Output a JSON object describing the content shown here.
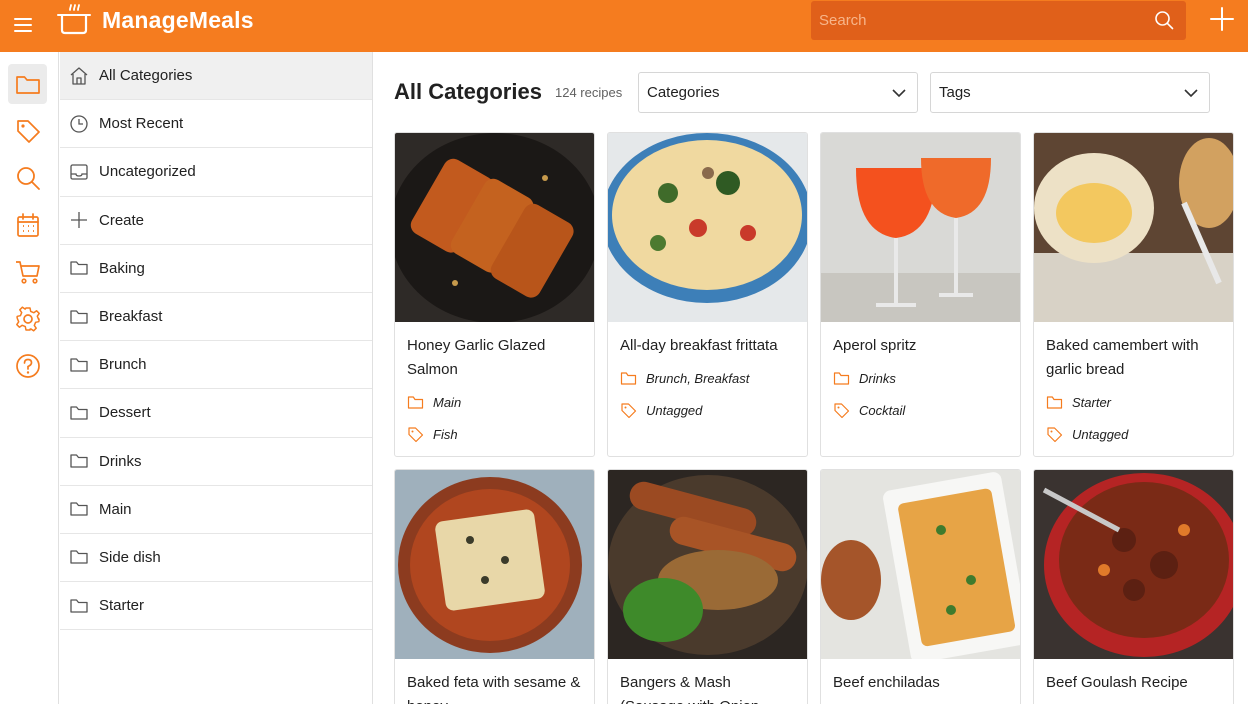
{
  "app": {
    "title": "ManageMeals",
    "accent": "#f57c1f"
  },
  "search": {
    "placeholder": "Search"
  },
  "rail": [
    "folder-icon",
    "tag-icon",
    "search-icon",
    "calendar-icon",
    "cart-icon",
    "gear-icon",
    "help-icon"
  ],
  "categories": [
    {
      "label": "All Categories",
      "icon": "home-icon",
      "active": true
    },
    {
      "label": "Most Recent",
      "icon": "clock-icon"
    },
    {
      "label": "Uncategorized",
      "icon": "inbox-icon"
    },
    {
      "label": "Create",
      "icon": "plus-icon"
    },
    {
      "label": "Baking",
      "icon": "folder-icon"
    },
    {
      "label": "Breakfast",
      "icon": "folder-icon"
    },
    {
      "label": "Brunch",
      "icon": "folder-icon"
    },
    {
      "label": "Dessert",
      "icon": "folder-icon"
    },
    {
      "label": "Drinks",
      "icon": "folder-icon"
    },
    {
      "label": "Main",
      "icon": "folder-icon"
    },
    {
      "label": "Side dish",
      "icon": "folder-icon"
    },
    {
      "label": "Starter",
      "icon": "folder-icon"
    }
  ],
  "main": {
    "title": "All Categories",
    "count": "124 recipes",
    "categories_select": "Categories",
    "tags_select": "Tags"
  },
  "recipes": [
    {
      "title": "Honey Garlic Glazed Salmon",
      "category": "Main",
      "tags": "Fish"
    },
    {
      "title": "All-day breakfast frittata",
      "category": "Brunch, Breakfast",
      "tags": "Untagged"
    },
    {
      "title": "Aperol spritz",
      "category": "Drinks",
      "tags": "Cocktail"
    },
    {
      "title": "Baked camembert with garlic bread",
      "category": "Starter",
      "tags": "Untagged"
    },
    {
      "title": "Baked feta with sesame & honey"
    },
    {
      "title": "Bangers & Mash (Sausage with Onion"
    },
    {
      "title": "Beef enchiladas"
    },
    {
      "title": "Beef Goulash Recipe"
    }
  ]
}
